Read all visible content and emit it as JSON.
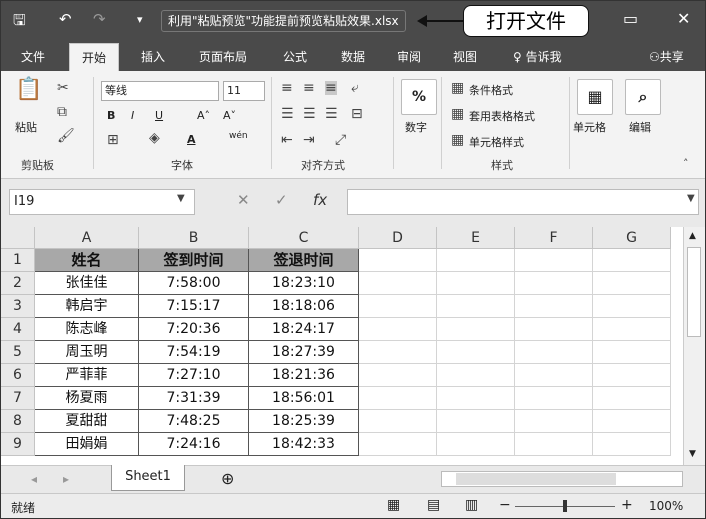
{
  "titlebar": {
    "file_title": "利用\"粘贴预览\"功能提前预览粘贴效果.xlsx",
    "callout": "打开文件",
    "save_glyph": "🖫",
    "undo_glyph": "↶",
    "redo_glyph": "↷",
    "qa_more_glyph": "▾",
    "restore_glyph": "▭",
    "minimize_glyph": "—",
    "close_glyph": "✕"
  },
  "tabs": [
    "文件",
    "开始",
    "插入",
    "页面布局",
    "公式",
    "数据",
    "审阅",
    "视图",
    "告诉我",
    "共享"
  ],
  "ribbon": {
    "paste_label": "粘贴",
    "clipboard_group": "剪贴板",
    "font_name": "等线",
    "font_size": "11",
    "font_group": "字体",
    "bold": "B",
    "italic": "I",
    "underline": "U",
    "grow": "A˄",
    "shrink": "A˅",
    "pinyin": "wén",
    "align_group": "对齐方式",
    "number_label": "数字",
    "percent": "%",
    "cond_format": "条件格式",
    "table_format": "套用表格格式",
    "cell_style": "单元格样式",
    "styles_group": "样式",
    "cells_label": "单元格",
    "edit_label": "编辑"
  },
  "formula_bar": {
    "name_box": "I19",
    "cancel": "✕",
    "enter": "✓",
    "fx": "fx"
  },
  "sheet": {
    "columns": [
      "A",
      "B",
      "C",
      "D",
      "E",
      "F",
      "G"
    ],
    "rows": [
      "1",
      "2",
      "3",
      "4",
      "5",
      "6",
      "7",
      "8",
      "9"
    ],
    "header": [
      "姓名",
      "签到时间",
      "签退时间"
    ],
    "data": [
      [
        "张佳佳",
        "7:58:00",
        "18:23:10"
      ],
      [
        "韩启宇",
        "7:15:17",
        "18:18:06"
      ],
      [
        "陈志峰",
        "7:20:36",
        "18:24:17"
      ],
      [
        "周玉明",
        "7:54:19",
        "18:27:39"
      ],
      [
        "严菲菲",
        "7:27:10",
        "18:21:36"
      ],
      [
        "杨夏雨",
        "7:31:39",
        "18:56:01"
      ],
      [
        "夏甜甜",
        "7:48:25",
        "18:25:39"
      ],
      [
        "田娟娟",
        "7:24:16",
        "18:42:33"
      ]
    ]
  },
  "sheet_tabs": {
    "active": "Sheet1",
    "add": "⊕"
  },
  "status": {
    "ready": "就绪",
    "zoom": "100%"
  }
}
